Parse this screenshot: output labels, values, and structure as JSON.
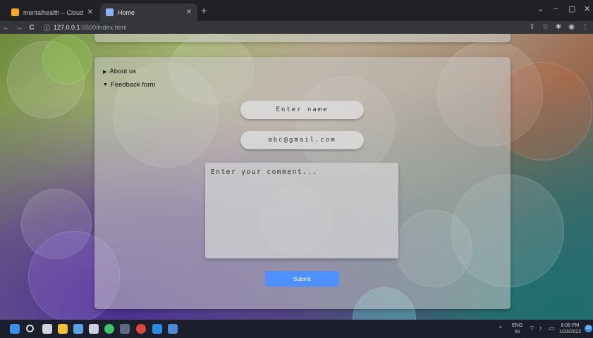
{
  "browser": {
    "tabs": [
      {
        "label": "mentalhealth – Cloud Firestore",
        "active": false
      },
      {
        "label": "Home",
        "active": true
      }
    ],
    "new_tab": "+",
    "window_controls": {
      "minimize": "–",
      "maximize": "▢",
      "close": "✕",
      "dropdown": "⌄"
    },
    "nav": {
      "back": "←",
      "forward": "→",
      "reload": "C"
    },
    "address": {
      "host": "127.0.0.1",
      "path": ":5500/index.html"
    }
  },
  "page": {
    "details": [
      {
        "label": "About us",
        "open": false,
        "marker": "▶"
      },
      {
        "label": "Feedback form",
        "open": true,
        "marker": "▼"
      }
    ],
    "form": {
      "name_placeholder": "Enter name",
      "email_placeholder": "abc@gmail.com",
      "comment_placeholder": "Enter your comment...",
      "submit_label": "Submit"
    }
  },
  "taskbar": {
    "language": "ENG",
    "region": "IN",
    "time": "8:08 PM",
    "date": "1/23/2022",
    "notification_count": "20",
    "chevron": "^"
  },
  "colors": {
    "submit": "#4d90fe",
    "taskbar": "#1b1f2b",
    "chrome": "#202124"
  }
}
